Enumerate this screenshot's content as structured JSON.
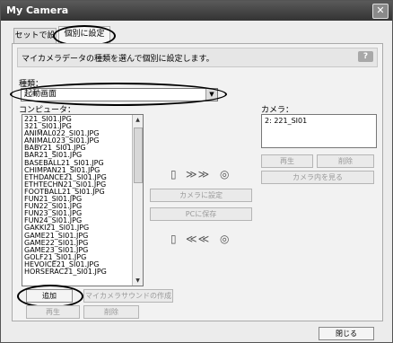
{
  "window": {
    "title": "My Camera",
    "close_glyph": "✕"
  },
  "tabs": [
    {
      "label": "セットで設定",
      "selected": false
    },
    {
      "label": "個別に設定",
      "selected": true
    }
  ],
  "panel": {
    "description": "マイカメラデータの種類を選んで個別に設定します。",
    "help_label": "?"
  },
  "type_select": {
    "label": "種類：",
    "value": "起動画面",
    "arrow_glyph": "▼"
  },
  "computer": {
    "label": "コンピュータ：",
    "files": [
      "221_SI01.JPG",
      "321_SI01.JPG",
      "ANIMAL022_SI01.JPG",
      "ANIMAL023_SI01.JPG",
      "BABY21_SI01.JPG",
      "BAR21_SI01.JPG",
      "BASEBALL21_SI01.JPG",
      "CHIMPAN21_SI01.JPG",
      "ETHDANCE21_SI01.JPG",
      "ETHTECHN21_SI01.JPG",
      "FOOTBALL21_SI01.JPG",
      "FUN21_SI01.JPG",
      "FUN22_SI01.JPG",
      "FUN23_SI01.JPG",
      "FUN24_SI01.JPG",
      "GAKKI21_SI01.JPG",
      "GAME21_SI01.JPG",
      "GAME22_SI01.JPG",
      "GAME23_SI01.JPG",
      "GOLF21_SI01.JPG",
      "HEVOICE21_SI01.JPG",
      "HORSERAC21_SI01.JPG"
    ]
  },
  "camera": {
    "label": "カメラ：",
    "files": [
      "2: 221_SI01"
    ]
  },
  "buttons": {
    "add": "追加",
    "mycamera_sound": "マイカメラサウンドの作成",
    "play_left": "再生",
    "delete_left": "削除",
    "play_right": "再生",
    "delete_right": "削除",
    "view_camera": "カメラ内を見る",
    "set_camera": "カメラに設定",
    "save_pc": "PCに保存",
    "close": "閉じる"
  },
  "transfer": {
    "to_camera": "≫≫",
    "to_pc": "≪≪"
  },
  "icons": [
    "phone-icon",
    "camera-icon",
    "arrow-right-icon",
    "arrow-left-icon",
    "scroll-up-icon",
    "scroll-down-icon"
  ]
}
